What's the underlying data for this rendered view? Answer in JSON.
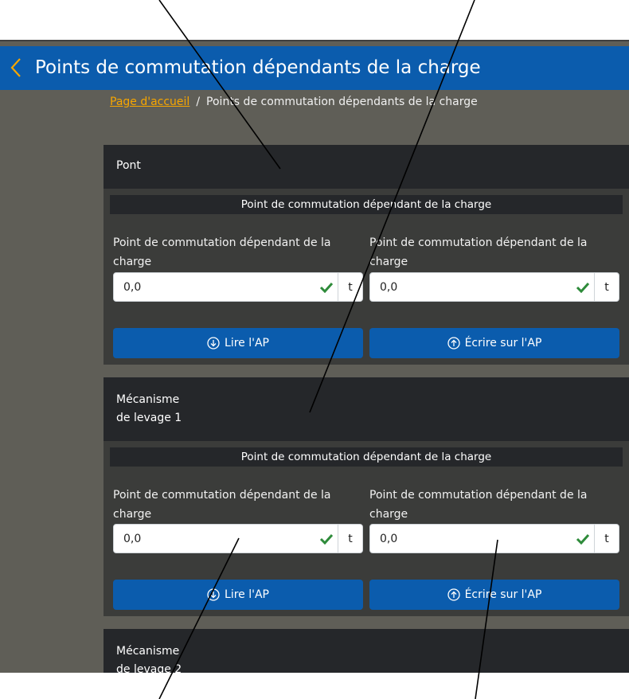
{
  "header": {
    "title": "Points de commutation dépendants de la charge"
  },
  "breadcrumb": {
    "home": "Page d'accueil",
    "separator": "/",
    "current": "Points de commutation dépendants de la charge"
  },
  "sections": [
    {
      "title_line1": "Pont",
      "title_line2": "",
      "subheader": "Point de commutation dépendant de la charge",
      "fields": [
        {
          "label": "Point de commutation dépendant de la charge",
          "index": "1",
          "value": "0,0",
          "unit": "t"
        },
        {
          "label": "Point de commutation dépendant de la charge",
          "index": "2",
          "value": "0,0",
          "unit": "t"
        }
      ],
      "read_label": "Lire l'AP",
      "write_label": "Écrire sur l'AP"
    },
    {
      "title_line1": "Mécanisme",
      "title_line2": "de levage 1",
      "subheader": "Point de commutation dépendant de la charge",
      "fields": [
        {
          "label": "Point de commutation dépendant de la charge",
          "index": "1",
          "value": "0,0",
          "unit": "t"
        },
        {
          "label": "Point de commutation dépendant de la charge",
          "index": "2",
          "value": "0,0",
          "unit": "t"
        }
      ],
      "read_label": "Lire l'AP",
      "write_label": "Écrire sur l'AP"
    },
    {
      "title_line1": "Mécanisme",
      "title_line2": "de levage 2"
    }
  ],
  "colors": {
    "brand_blue": "#0b5cad",
    "link_orange": "#f7a600",
    "valid_green": "#2e8b3a"
  }
}
